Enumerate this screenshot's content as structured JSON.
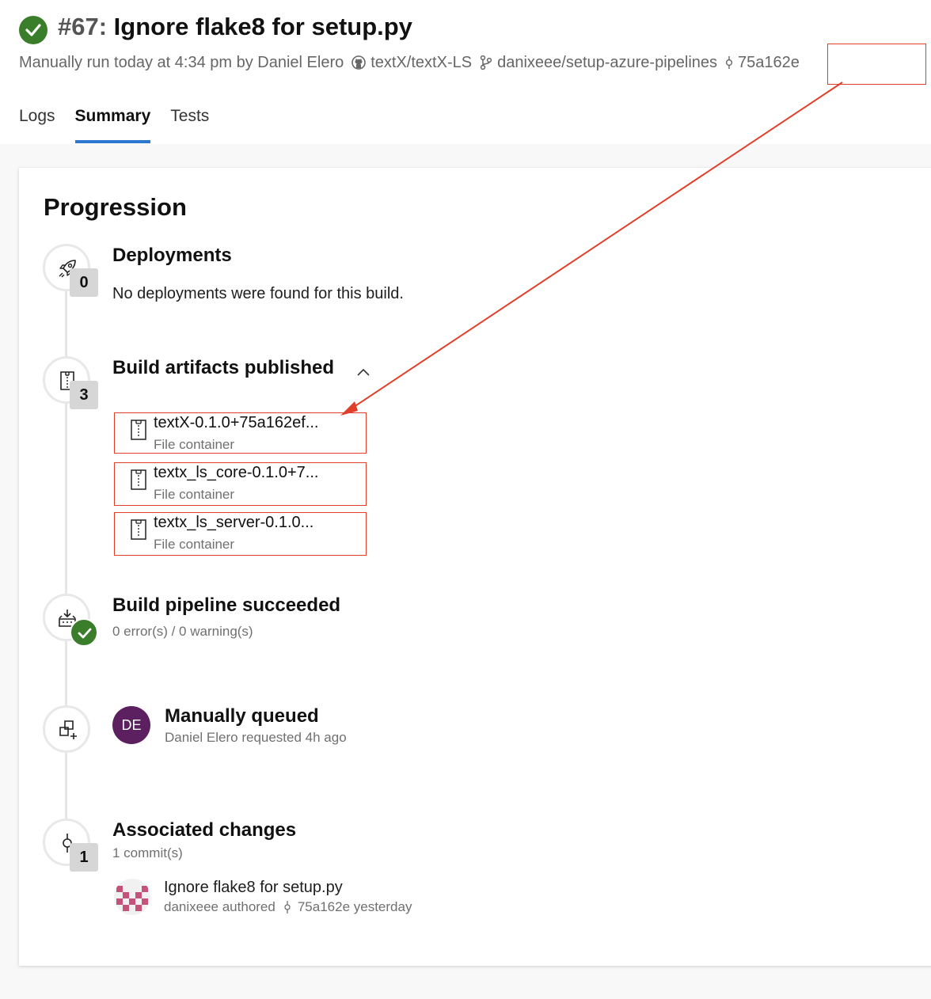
{
  "header": {
    "run_number": "#67:",
    "title": "Ignore flake8 for setup.py",
    "run_info": "Manually run today at 4:34 pm by Daniel Elero",
    "repo": "textX/textX-LS",
    "branch": "danixeee/setup-azure-pipelines",
    "commit": "75a162e"
  },
  "tabs": [
    {
      "label": "Logs",
      "active": false
    },
    {
      "label": "Summary",
      "active": true
    },
    {
      "label": "Tests",
      "active": false
    }
  ],
  "progression": {
    "title": "Progression",
    "deployments": {
      "title": "Deployments",
      "count": "0",
      "message": "No deployments were found for this build.",
      "icon": "rocket-icon"
    },
    "artifacts": {
      "title": "Build artifacts published",
      "count": "3",
      "icon": "artifact-icon",
      "items": [
        {
          "name": "textX-0.1.0+75a162ef...",
          "type": "File container"
        },
        {
          "name": "textx_ls_core-0.1.0+7...",
          "type": "File container"
        },
        {
          "name": "textx_ls_server-0.1.0...",
          "type": "File container"
        }
      ]
    },
    "pipeline": {
      "title": "Build pipeline succeeded",
      "detail": "0 error(s) / 0 warning(s)",
      "icon": "pipeline-icon"
    },
    "queued": {
      "title": "Manually queued",
      "detail": "Daniel Elero requested 4h ago",
      "avatar_initials": "DE",
      "icon": "queue-icon"
    },
    "changes": {
      "title": "Associated changes",
      "count": "1",
      "detail": "1 commit(s)",
      "icon": "commit-icon",
      "commit_message": "Ignore flake8 for setup.py",
      "author_text": "danixeee authored",
      "commit_text": "75a162e yesterday"
    }
  },
  "colors": {
    "success": "#3a7d2a",
    "accent": "#2b78d0",
    "annotation": "#e0402a",
    "avatar": "#5c1f60"
  }
}
